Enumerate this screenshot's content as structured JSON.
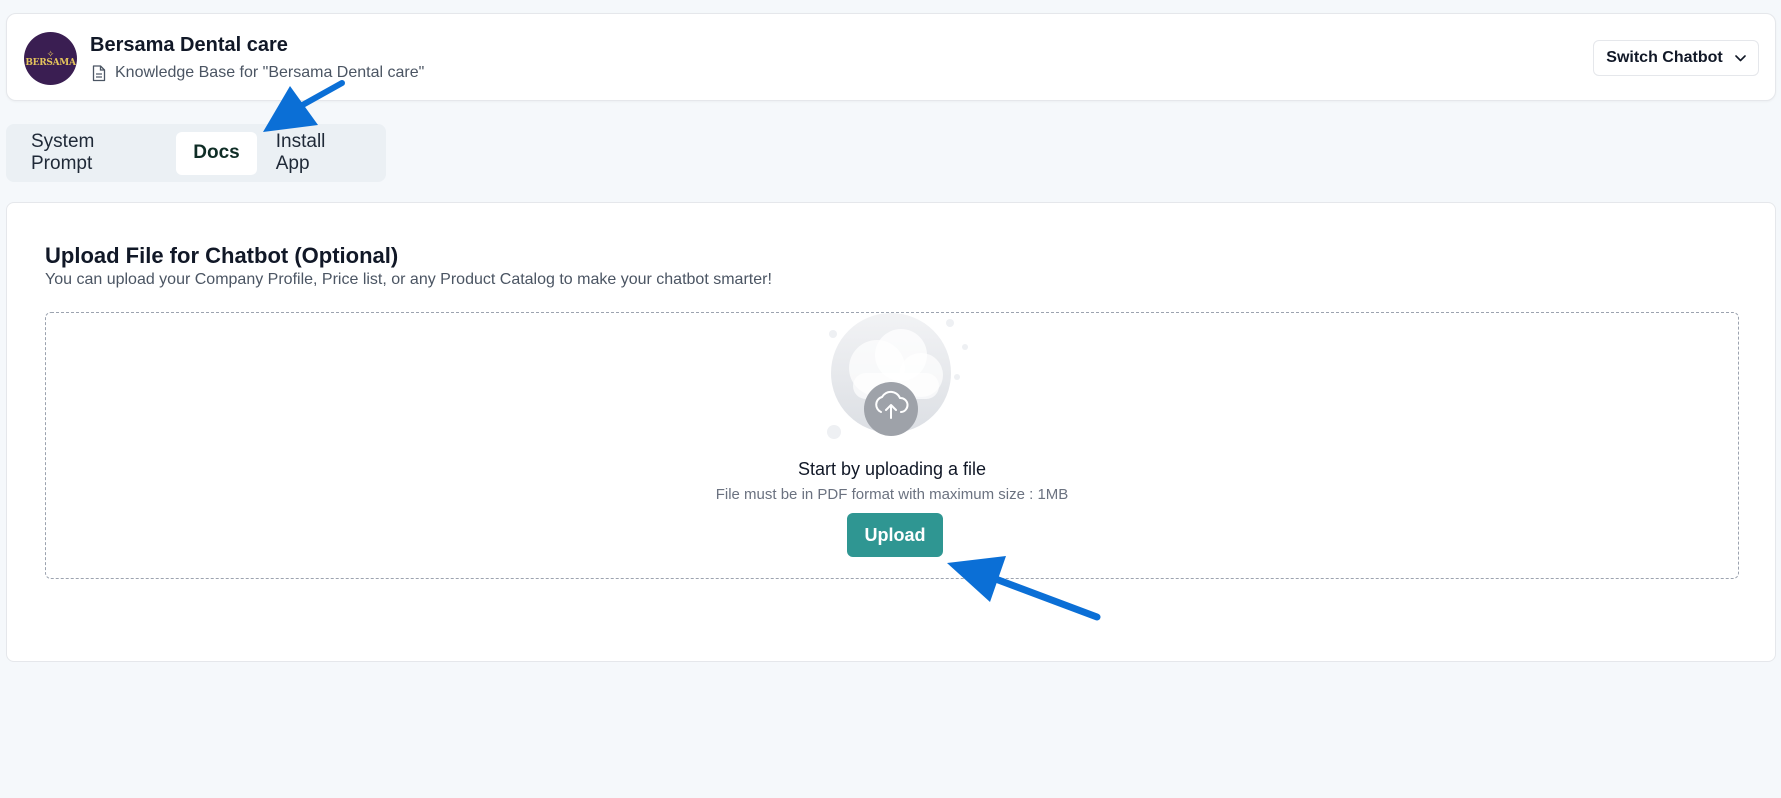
{
  "header": {
    "bot_name": "Bersama Dental care",
    "avatar_text": "BERSAMA",
    "kb_label": "Knowledge Base for \"Bersama Dental care\"",
    "switch_label": "Switch Chatbot"
  },
  "tabs": [
    {
      "label": "System Prompt",
      "active": false
    },
    {
      "label": "Docs",
      "active": true
    },
    {
      "label": "Install App",
      "active": false
    }
  ],
  "upload_section": {
    "title": "Upload File for Chatbot (Optional)",
    "subtitle": "You can upload your Company Profile, Price list, or any Product Catalog to make your chatbot smarter!",
    "drop_title": "Start by uploading a file",
    "drop_hint": "File must be in PDF format with maximum size : 1MB",
    "upload_label": "Upload"
  },
  "colors": {
    "accent": "#2f9692",
    "annotation_arrow": "#0b6fd6",
    "avatar_bg": "#3a1e52"
  },
  "icons": [
    "document-icon",
    "chevron-down-icon",
    "cloud-upload-icon"
  ]
}
